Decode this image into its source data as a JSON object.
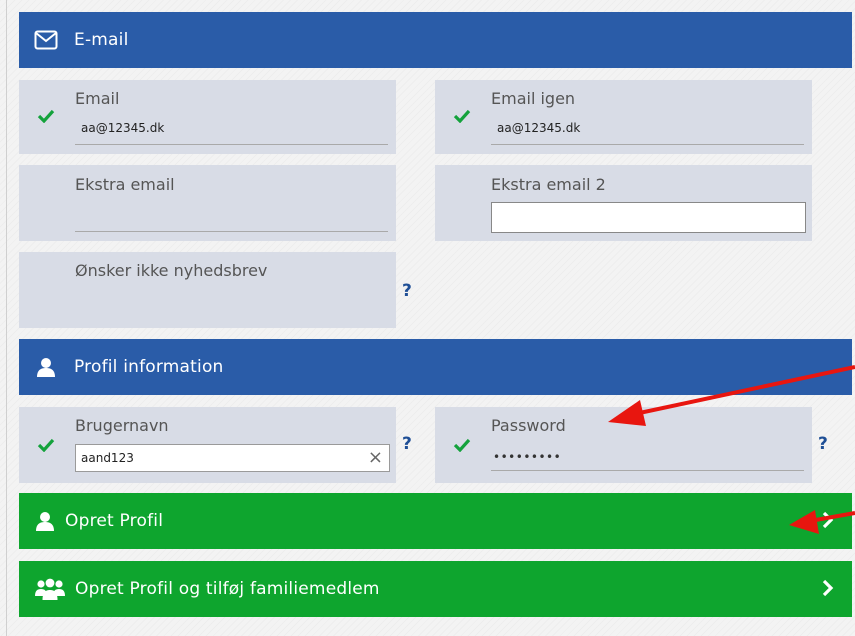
{
  "email_section": {
    "title": "E-mail",
    "icon": "envelope-icon",
    "email": {
      "label": "Email",
      "value": "aa@12345.dk"
    },
    "email_again": {
      "label": "Email igen",
      "value": "aa@12345.dk"
    },
    "extra_email": {
      "label": "Ekstra email",
      "value": ""
    },
    "extra_email_2": {
      "label": "Ekstra email 2",
      "value": ""
    },
    "newsletter": {
      "label": "Ønsker ikke nyhedsbrev"
    }
  },
  "profile_section": {
    "title": "Profil information",
    "icon": "user-icon",
    "username": {
      "label": "Brugernavn",
      "value": "aand123"
    },
    "password": {
      "label": "Password",
      "value": "•••••••••"
    }
  },
  "help_symbol": "?",
  "clear_symbol": "×",
  "buttons": {
    "create_profile": "Opret Profil",
    "create_profile_family": "Opret Profil og tilføj familiemedlem"
  },
  "colors": {
    "header_blue": "#2a5ca8",
    "button_green": "#0ea52e",
    "field_bg": "#d8dce6",
    "check_green": "#14a23c",
    "help_blue": "#1f4f96",
    "annotation_red": "#e8160f"
  }
}
